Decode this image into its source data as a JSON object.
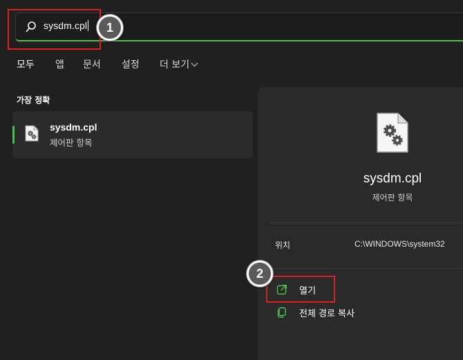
{
  "search": {
    "query": "sysdm.cpl"
  },
  "tabs": [
    {
      "label": "모두"
    },
    {
      "label": "앱"
    },
    {
      "label": "문서"
    },
    {
      "label": "설정"
    },
    {
      "label": "더 보기"
    }
  ],
  "best_match": {
    "heading": "가장 정확",
    "item": {
      "title": "sysdm.cpl",
      "subtitle": "제어판 항목"
    }
  },
  "preview": {
    "title": "sysdm.cpl",
    "subtitle": "제어판 항목",
    "location_label": "위치",
    "location_value": "C:\\WINDOWS\\system32",
    "actions": [
      {
        "label": "열기",
        "icon": "open-external-icon"
      },
      {
        "label": "전체 경로 복사",
        "icon": "copy-path-icon"
      }
    ]
  },
  "markers": [
    "1",
    "2"
  ],
  "colors": {
    "background": "#202020",
    "panel": "#2a2a2a",
    "accent": "#4cc24a",
    "highlight": "#e02020"
  }
}
